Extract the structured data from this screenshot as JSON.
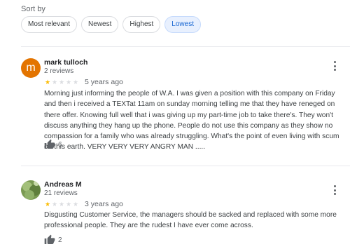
{
  "sort": {
    "label": "Sort by",
    "options": [
      "Most relevant",
      "Newest",
      "Highest",
      "Lowest"
    ],
    "selected": "Lowest"
  },
  "colors": {
    "star_filled": "#fbbc04",
    "star_empty": "#dadce0",
    "chip_selected_bg": "#e8f0fe",
    "avatar_orange": "#e37400"
  },
  "reviews": [
    {
      "name": "mark tulloch",
      "review_count": "2 reviews",
      "avatar_letter": "m",
      "rating": 1,
      "max_rating": 5,
      "time": "5 years ago",
      "text": "Morning just informing the people of W.A. I was given a position with this company on Friday and then i received a TEXTat 11am on sunday morning telling me that they have reneged on there offer. Knowing full well that i was giving up my part-time job to take there's. They won't discuss anything they hang up the phone. People do not use this company as they show no compassion for a family who was already struggling. What's the point of even living with scum on this earth. VERY VERY VERY ANGRY MAN .....",
      "likes": "6",
      "like_icon": "thumb-up-icon",
      "menu_icon": "more-vert-icon"
    },
    {
      "name": "Andreas M",
      "review_count": "21 reviews",
      "avatar_letter": "",
      "rating": 1,
      "max_rating": 5,
      "time": "3 years ago",
      "text": "Disgusting Customer Service, the managers should be sacked and replaced with some more professional people. They are the rudest I have ever come across.",
      "likes": "2",
      "like_icon": "thumb-up-icon",
      "menu_icon": "more-vert-icon"
    }
  ]
}
